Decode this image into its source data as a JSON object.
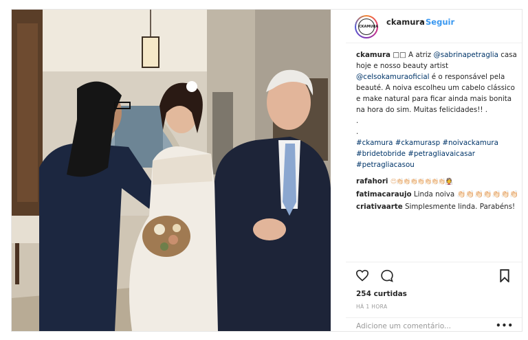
{
  "header": {
    "avatar_text": "CKAMURA",
    "username": "ckamura",
    "separator": "•",
    "follow_label": "Seguir"
  },
  "caption": {
    "username": "ckamura",
    "part1": " □□ A atriz ",
    "mention1": "@sabrinapetraglia",
    "part2": " casa hoje e nosso beauty artist ",
    "mention2": "@celsokamuraoficial",
    "part3": " é o responsável pela beauté. A noiva escolheu um cabelo clássico e make natural para ficar ainda mais bonita na hora do sim. Muitas felicidades!! .",
    "dot1": ".",
    "dot2": ".",
    "hashtags": "#ckamura #ckamurasp #noivackamura #bridetobride #petragliavaicasar #petragliacasou"
  },
  "comments": [
    {
      "user": "rafahori",
      "text": "😍👏🏻👏🏻👏🏻👏🏻👏🏻👏🏻👏🏻👰"
    },
    {
      "user": "fatimacaraujo",
      "text": "Linda noiva 👏🏻👏🏻👏🏻👏🏻👏🏻👏🏻👏🏻"
    },
    {
      "user": "criativaarte",
      "text": "Simplesmente linda. Parabéns!"
    }
  ],
  "actions": {
    "like_icon": "heart-icon",
    "comment_icon": "comment-icon",
    "save_icon": "bookmark-icon",
    "likes_text": "254 curtidas",
    "time_text": "HÁ 1 HORA"
  },
  "add_comment": {
    "placeholder": "Adicione um comentário...",
    "more_label": "•••"
  },
  "colors": {
    "link": "#003569",
    "follow": "#3897f0",
    "muted": "#999999"
  }
}
